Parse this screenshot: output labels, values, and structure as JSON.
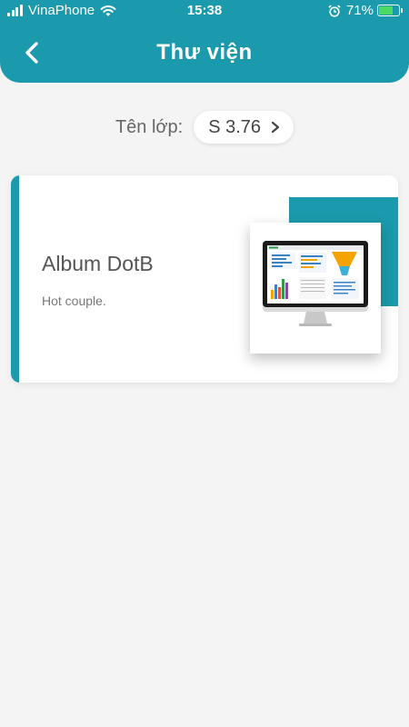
{
  "status_bar": {
    "carrier": "VinaPhone",
    "time": "15:38",
    "battery_percent": "71%",
    "battery_level": 0.71,
    "icons": [
      "signal-icon",
      "wifi-icon",
      "alarm-icon",
      "battery-icon"
    ]
  },
  "header": {
    "title": "Thư viện",
    "back_icon": "chevron-left-icon"
  },
  "class_selector": {
    "label": "Tên lớp:",
    "value": "S 3.76",
    "icon": "chevron-right-icon"
  },
  "albums": [
    {
      "title": "Album DotB",
      "description": "Hot couple.",
      "thumbnail": "monitor-dashboard-image"
    }
  ],
  "colors": {
    "primary": "#1a9aac",
    "background": "#f4f4f4",
    "card": "#ffffff",
    "battery_green": "#4cd964"
  }
}
